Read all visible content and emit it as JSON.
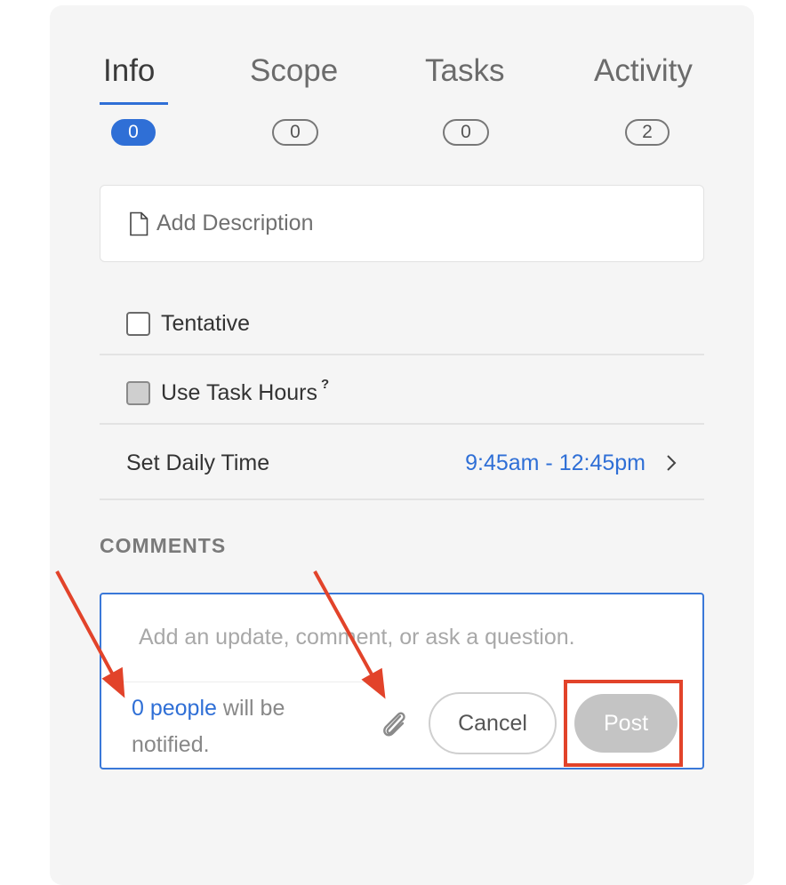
{
  "tabs": [
    {
      "label": "Info",
      "count": "0",
      "active": true
    },
    {
      "label": "Scope",
      "count": "0",
      "active": false
    },
    {
      "label": "Tasks",
      "count": "0",
      "active": false
    },
    {
      "label": "Activity",
      "count": "2",
      "active": false
    }
  ],
  "description": {
    "placeholder": "Add Description"
  },
  "options": {
    "tentative_label": "Tentative",
    "tentative_checked": false,
    "task_hours_label": "Use Task Hours",
    "task_hours_help": "?",
    "task_hours_checked": false
  },
  "daily_time": {
    "label": "Set Daily Time",
    "value": "9:45am - 12:45pm"
  },
  "comments": {
    "title": "COMMENTS",
    "placeholder": "Add an update, comment, or ask a question.",
    "people_link": "0 people",
    "notify_suffix": "will be notified.",
    "cancel_label": "Cancel",
    "post_label": "Post"
  },
  "colors": {
    "accent": "#2f6fd6",
    "annotation": "#e2432a",
    "panel": "#f5f5f5"
  },
  "icons": [
    "document-icon",
    "chevron-right-icon",
    "paperclip-icon",
    "help-icon"
  ]
}
